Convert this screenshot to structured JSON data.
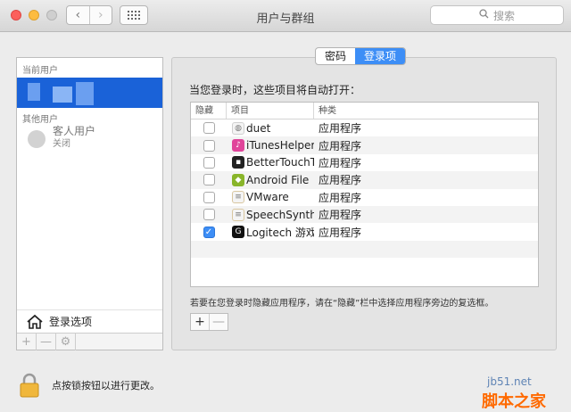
{
  "window": {
    "title": "用户与群组"
  },
  "toolbar": {
    "back_icon": "chevron-left-icon",
    "forward_icon": "chevron-right-icon",
    "grid_icon": "grid-icon",
    "search_placeholder": "搜索"
  },
  "sidebar": {
    "current_user_section": "当前用户",
    "other_users_section": "其他用户",
    "guest_name": "客人用户",
    "guest_status": "关闭",
    "login_options": "登录选项",
    "tools": [
      "+",
      "—",
      "⚙"
    ]
  },
  "tabs": [
    {
      "label": "密码",
      "active": false
    },
    {
      "label": "登录项",
      "active": true
    }
  ],
  "panel": {
    "title": "当您登录时，这些项目将自动打开：",
    "columns": [
      "隐藏",
      "项目",
      "种类"
    ],
    "items": [
      {
        "hidden": false,
        "name": "duet",
        "kind": "应用程序",
        "icon": "duet-icon",
        "color": "#cfcfcf"
      },
      {
        "hidden": false,
        "name": "iTunesHelper",
        "kind": "应用程序",
        "icon": "itunes-icon",
        "color": "#e0449a"
      },
      {
        "hidden": false,
        "name": "BetterTouchT",
        "kind": "应用程序",
        "icon": "terminal-icon",
        "color": "#222222"
      },
      {
        "hidden": false,
        "name": "Android File",
        "kind": "应用程序",
        "icon": "android-icon",
        "color": "#89b52a"
      },
      {
        "hidden": false,
        "name": "VMware",
        "kind": "应用程序",
        "icon": "script-icon",
        "color": "#d9c7a0"
      },
      {
        "hidden": false,
        "name": "SpeechSynth",
        "kind": "应用程序",
        "icon": "script-icon",
        "color": "#d9c7a0"
      },
      {
        "hidden": true,
        "name": "Logitech 游戏",
        "kind": "应用程序",
        "icon": "logitech-icon",
        "color": "#111111"
      }
    ],
    "hint": "若要在您登录时隐藏应用程序，请在“隐藏”栏中选择应用程序旁边的复选框。",
    "add": "+",
    "remove": "—"
  },
  "footer": {
    "lock_text": "点按锁按钮以进行更改。"
  },
  "watermark": {
    "line1": "jb51.net",
    "line2": "脚本之家"
  }
}
